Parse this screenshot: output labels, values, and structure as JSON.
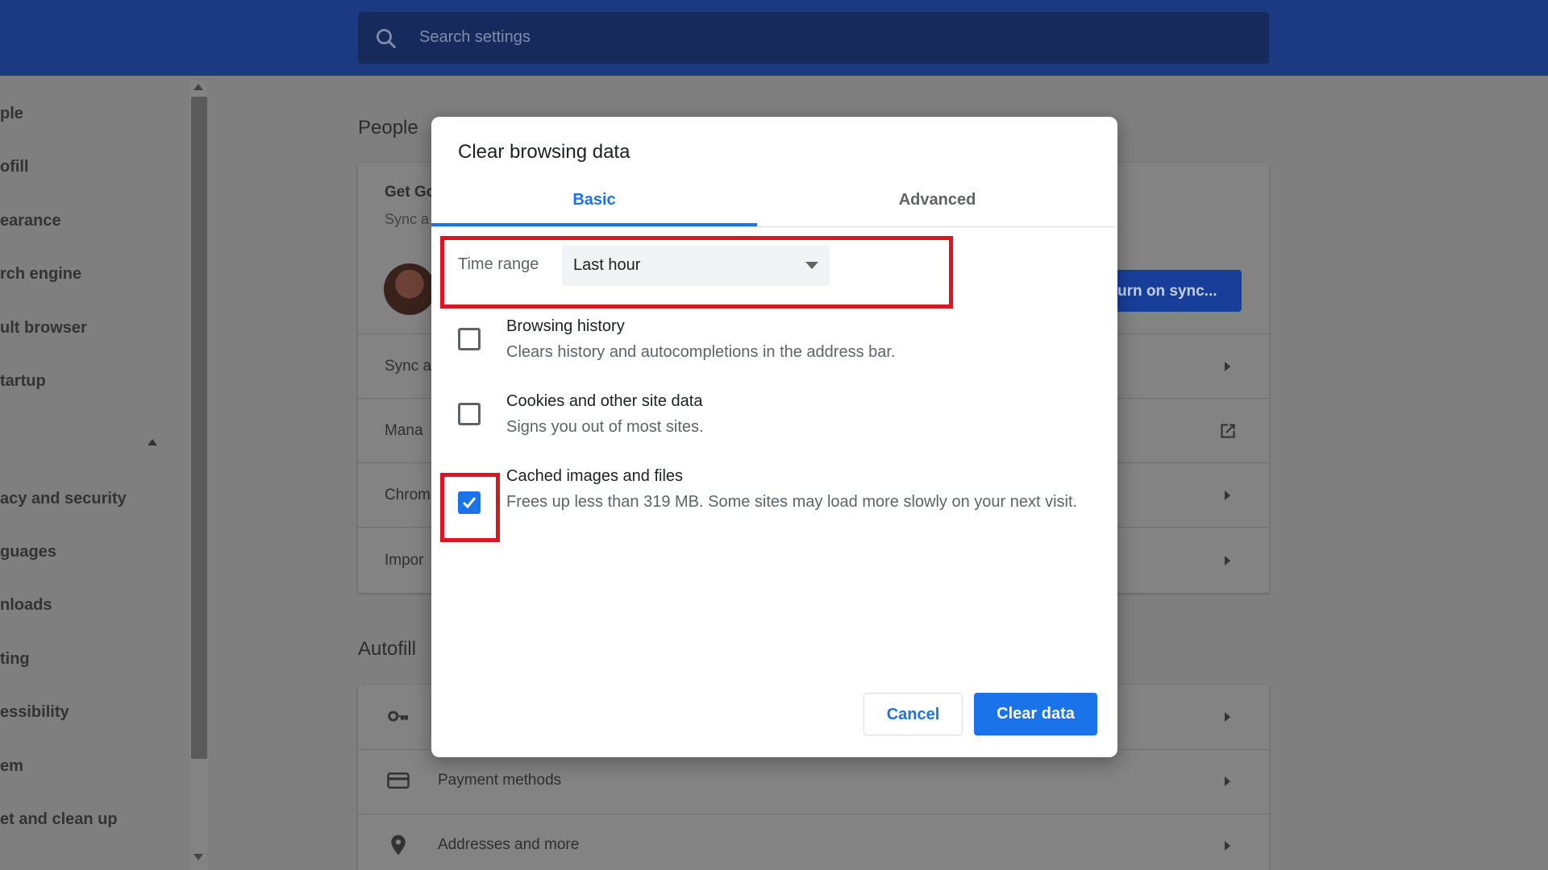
{
  "search": {
    "placeholder": "Search settings"
  },
  "sidebar": {
    "items": [
      "ple",
      "ofill",
      "earance",
      "rch engine",
      "ult browser",
      "tartup",
      "acy and security",
      "guages",
      "nloads",
      "ting",
      "essibility",
      "em",
      "et and clean up"
    ]
  },
  "people": {
    "title": "People",
    "get_google": "Get Go",
    "sync_sub": "Sync a",
    "sync_button": "urn on sync...",
    "rows": [
      "Sync a",
      "Mana",
      "Chrom",
      "Impor"
    ]
  },
  "autofill": {
    "title": "Autofill",
    "rows": [
      "Payment methods",
      "Addresses and more"
    ]
  },
  "dialog": {
    "title": "Clear browsing data",
    "tabs": {
      "basic": "Basic",
      "advanced": "Advanced"
    },
    "time_range": {
      "label": "Time range",
      "value": "Last hour"
    },
    "items": [
      {
        "title": "Browsing history",
        "description": "Clears history and autocompletions in the address bar.",
        "checked": false
      },
      {
        "title": "Cookies and other site data",
        "description": "Signs you out of most sites.",
        "checked": false
      },
      {
        "title": "Cached images and files",
        "description": "Frees up less than 319 MB. Some sites may load more slowly on your next visit.",
        "checked": true
      }
    ],
    "buttons": {
      "cancel": "Cancel",
      "clear": "Clear data"
    }
  },
  "colors": {
    "accent": "#1a73e8",
    "highlight": "#e0141e",
    "topbar": "#1b3a82"
  },
  "icons": [
    "search-icon",
    "key-icon",
    "credit-card-icon",
    "location-pin-icon",
    "external-link-icon",
    "dropdown-arrow-icon",
    "checkmark-icon"
  ]
}
